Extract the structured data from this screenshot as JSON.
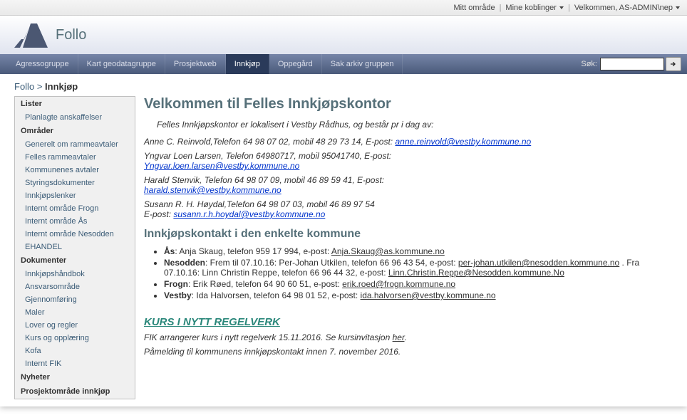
{
  "utility": {
    "my_area": "Mitt område",
    "my_links": "Mine koblinger",
    "welcome": "Velkommen, AS-ADMIN\\nep"
  },
  "header": {
    "site_title": "Follo"
  },
  "nav": {
    "items": [
      {
        "label": "Agressogruppe",
        "active": false
      },
      {
        "label": "Kart geodatagruppe",
        "active": false
      },
      {
        "label": "Prosjektweb",
        "active": false
      },
      {
        "label": "Innkjøp",
        "active": true
      },
      {
        "label": "Oppegård",
        "active": false
      },
      {
        "label": "Sak arkiv gruppen",
        "active": false
      }
    ],
    "search_label": "Søk:",
    "search_placeholder": ""
  },
  "breadcrumb": {
    "root": "Follo",
    "sep": ">",
    "current": "Innkjøp"
  },
  "sidebar": [
    {
      "type": "head",
      "label": "Lister"
    },
    {
      "type": "link",
      "label": "Planlagte anskaffelser"
    },
    {
      "type": "head",
      "label": "Områder"
    },
    {
      "type": "link",
      "label": "Generelt om rammeavtaler"
    },
    {
      "type": "link",
      "label": "Felles rammeavtaler"
    },
    {
      "type": "link",
      "label": "Kommunenes avtaler"
    },
    {
      "type": "link",
      "label": "Styringsdokumenter"
    },
    {
      "type": "link",
      "label": "Innkjøpslenker"
    },
    {
      "type": "link",
      "label": "Internt område Frogn"
    },
    {
      "type": "link",
      "label": "Internt område Ås"
    },
    {
      "type": "link",
      "label": "Internt område Nesodden"
    },
    {
      "type": "link",
      "label": "EHANDEL"
    },
    {
      "type": "head",
      "label": "Dokumenter"
    },
    {
      "type": "link",
      "label": "Innkjøpshåndbok"
    },
    {
      "type": "link",
      "label": "Ansvarsområde"
    },
    {
      "type": "link",
      "label": "Gjennomføring"
    },
    {
      "type": "link",
      "label": "Maler"
    },
    {
      "type": "link",
      "label": "Lover og regler"
    },
    {
      "type": "link",
      "label": "Kurs og opplæring"
    },
    {
      "type": "link",
      "label": "Kofa"
    },
    {
      "type": "link",
      "label": "Internt FIK"
    },
    {
      "type": "head",
      "label": "Nyheter"
    },
    {
      "type": "head",
      "label": "Prosjektområde innkjøp"
    }
  ],
  "content": {
    "h1": "Velkommen til Felles Innkjøpskontor",
    "intro": "Felles Innkjøpskontor er lokalisert i Vestby Rådhus, og består pr i dag av:",
    "people": [
      {
        "line": "Anne C. Reinvold,Telefon 64 98 07 02, mobil 48 29 73 14, E-post:",
        "email": "anne.reinvold@vestby.kommune.no",
        "inline": true
      },
      {
        "line": "Yngvar Loen Larsen, Telefon 64980717, mobil 95041740, E-post:",
        "email": "Yngvar.loen.larsen@vestby.kommune.no",
        "inline": false
      },
      {
        "line": "Harald Stenvik, Telefon 64 98 07 09,  mobil 46 89 59 41, E-post:",
        "email": "harald.stenvik@vestby.kommune.no",
        "inline": false
      },
      {
        "line": "Susann R. H. Høydal,Telefon 64 98 07 03, mobil 46 89 97 54",
        "email_label": "E-post:",
        "email": "susann.r.h.hoydal@vestby.kommune.no",
        "inline": false
      }
    ],
    "h2_contacts": "Innkjøpskontakt i den enkelte kommune",
    "contacts": [
      {
        "bold": "Ås",
        "text": ": Anja Skaug, telefon 959 17 994, e-post: ",
        "email": "Anja.Skaug@as.kommune.no"
      },
      {
        "bold": "Nesodden",
        "text": ": Frem til 07.10.16: Per-Johan Utkilen, telefon 66 96 43 54, e-post: ",
        "email": "per-johan.utkilen@nesodden.kommune.no",
        "text2": " . Fra 07.10.16: Linn Christin Reppe, telefon 66 96 44 32, e-post: ",
        "email2": "Linn.Christin.Reppe@Nesodden.kommune.No"
      },
      {
        "bold": "Frogn",
        "text": ": Erik Røed, telefon 64 90 60 51, e-post: ",
        "email": "erik.roed@frogn.kommune.no"
      },
      {
        "bold": "Vestby",
        "text": ": Ida Halvorsen, telefon 64 98 01 52, e-post: ",
        "email": "ida.halvorsen@vestby.kommune.no"
      }
    ],
    "kurs_heading": "KURS I NYTT REGELVERK",
    "kurs_line1a": "FIK arrangerer kurs i nytt regelverk 15.11.2016. Se kursinvitasjon ",
    "kurs_line1_link": "her",
    "kurs_line1b": ".",
    "kurs_line2": "Påmelding til kommunens innkjøpskontakt innen 7. november 2016."
  }
}
